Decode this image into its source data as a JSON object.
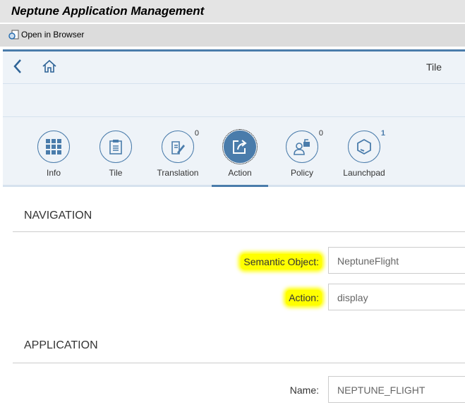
{
  "window": {
    "title": "Neptune Application Management"
  },
  "toolbar": {
    "open_in_browser": "Open in Browser"
  },
  "header": {
    "title": "Tile"
  },
  "tabs": [
    {
      "label": "Info",
      "badge": null
    },
    {
      "label": "Tile",
      "badge": null
    },
    {
      "label": "Translation",
      "badge": "0"
    },
    {
      "label": "Action",
      "badge": null
    },
    {
      "label": "Policy",
      "badge": "0"
    },
    {
      "label": "Launchpad",
      "badge": "1"
    }
  ],
  "navigation": {
    "heading": "NAVIGATION",
    "semantic_object_label": "Semantic Object:",
    "semantic_object_value": "NeptuneFlight",
    "action_label": "Action:",
    "action_value": "display"
  },
  "application": {
    "heading": "APPLICATION",
    "name_label": "Name:",
    "name_value": "NEPTUNE_FLIGHT"
  },
  "colors": {
    "accent": "#4a7cab",
    "highlight": "#ffff00"
  }
}
